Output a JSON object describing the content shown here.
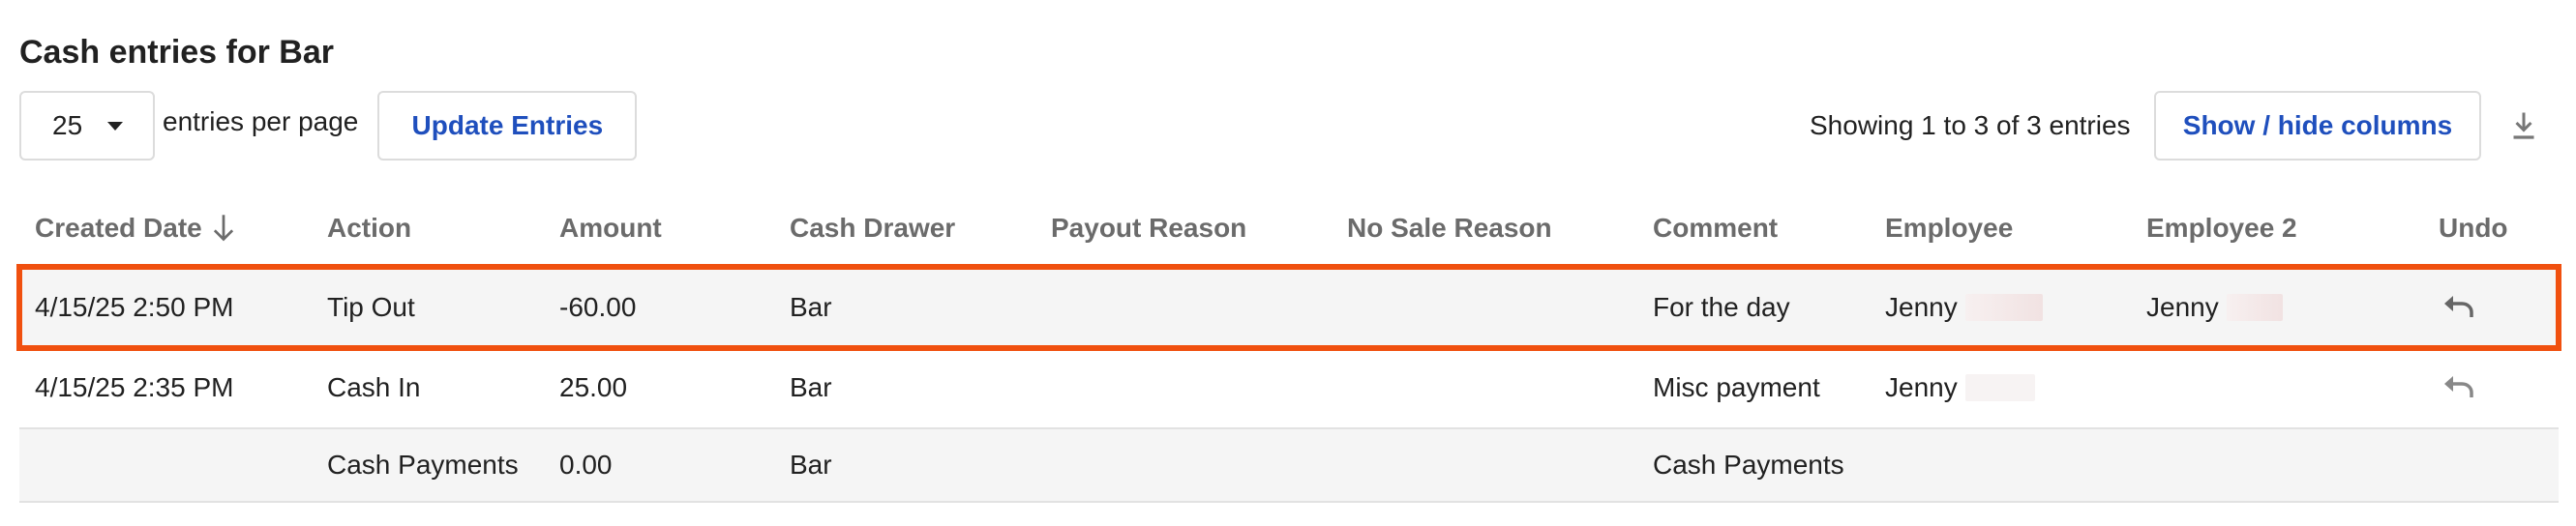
{
  "page": {
    "title": "Cash entries for Bar"
  },
  "toolbar": {
    "per_page_value": "25",
    "per_page_label": "entries per page",
    "update_label": "Update Entries",
    "showing_text": "Showing 1 to 3 of 3 entries",
    "columns_label": "Show / hide columns",
    "download_icon": "download-icon"
  },
  "table": {
    "headers": {
      "created_date": "Created Date",
      "action": "Action",
      "amount": "Amount",
      "cash_drawer": "Cash Drawer",
      "payout_reason": "Payout Reason",
      "no_sale_reason": "No Sale Reason",
      "comment": "Comment",
      "employee": "Employee",
      "employee2": "Employee 2",
      "undo": "Undo"
    },
    "sort": {
      "column": "created_date",
      "direction": "descending"
    },
    "rows": [
      {
        "created_date": "4/15/25 2:50 PM",
        "action": "Tip Out",
        "amount": "-60.00",
        "cash_drawer": "Bar",
        "payout_reason": "",
        "no_sale_reason": "",
        "comment": "For the day",
        "employee": "Jenny",
        "employee2": "Jenny",
        "undo": true,
        "highlighted": true
      },
      {
        "created_date": "4/15/25 2:35 PM",
        "action": "Cash In",
        "amount": "25.00",
        "cash_drawer": "Bar",
        "payout_reason": "",
        "no_sale_reason": "",
        "comment": "Misc payment",
        "employee": "Jenny",
        "employee2": "",
        "undo": true,
        "highlighted": false
      },
      {
        "created_date": "",
        "action": "Cash Payments",
        "amount": "0.00",
        "cash_drawer": "Bar",
        "payout_reason": "",
        "no_sale_reason": "",
        "comment": "Cash Payments",
        "employee": "",
        "employee2": "",
        "undo": false,
        "highlighted": false
      }
    ]
  },
  "colors": {
    "accent": "#1f4fbd",
    "highlight_border": "#f0500f",
    "header_text": "#6b6b6b",
    "row_shade": "#f5f5f5"
  }
}
